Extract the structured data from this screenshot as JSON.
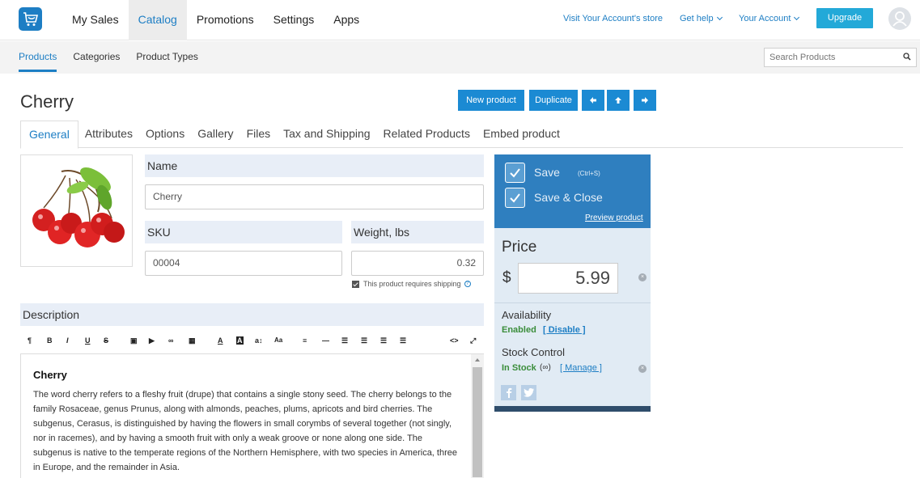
{
  "topnav": {
    "items": [
      "My Sales",
      "Catalog",
      "Promotions",
      "Settings",
      "Apps"
    ],
    "active": "Catalog",
    "store_link": "Visit Your Account's store",
    "help": "Get help",
    "account": "Your Account",
    "upgrade": "Upgrade"
  },
  "subnav": {
    "items": [
      "Products",
      "Categories",
      "Product Types"
    ],
    "active": "Products",
    "search_placeholder": "Search Products"
  },
  "page": {
    "title": "Cherry",
    "buttons": {
      "new_product": "New product",
      "duplicate": "Duplicate"
    }
  },
  "tabs": [
    "General",
    "Attributes",
    "Options",
    "Gallery",
    "Files",
    "Tax and Shipping",
    "Related Products",
    "Embed product"
  ],
  "form": {
    "name_label": "Name",
    "name_value": "Cherry",
    "sku_label": "SKU",
    "sku_value": "00004",
    "weight_label": "Weight, lbs",
    "weight_value": "0.32",
    "shipping_note": "This product requires shipping",
    "description_label": "Description"
  },
  "description": {
    "heading": "Cherry",
    "body": "The word cherry refers to a fleshy fruit (drupe) that contains a single stony seed. The cherry belongs to the family Rosaceae, genus Prunus, along with almonds, peaches, plums, apricots and bird cherries. The subgenus, Cerasus, is distinguished by having the flowers in small corymbs of several together (not singly, nor in racemes), and by having a smooth fruit with only a weak groove or none along one side. The subgenus is native to the temperate regions of the Northern Hemisphere, with two species in America, three in Europe, and the remainder in Asia."
  },
  "panel": {
    "save": "Save",
    "save_shortcut": "(Ctrl+S)",
    "save_close": "Save & Close",
    "preview": "Preview product",
    "price_label": "Price",
    "currency": "$",
    "price_value": "5.99",
    "availability_label": "Availability",
    "availability_status": "Enabled",
    "disable_link": "[ Disable ]",
    "stock_label": "Stock Control",
    "stock_status": "In Stock",
    "stock_infinity": "(∞)",
    "manage_link": "[ Manage ]"
  },
  "colors": {
    "accent": "#1d7ec4",
    "button": "#1b8ad3",
    "upgrade": "#23a9d8",
    "panel_header": "#2f7fbf",
    "panel_body": "#e1ebf4",
    "enabled": "#3a8d3a"
  }
}
